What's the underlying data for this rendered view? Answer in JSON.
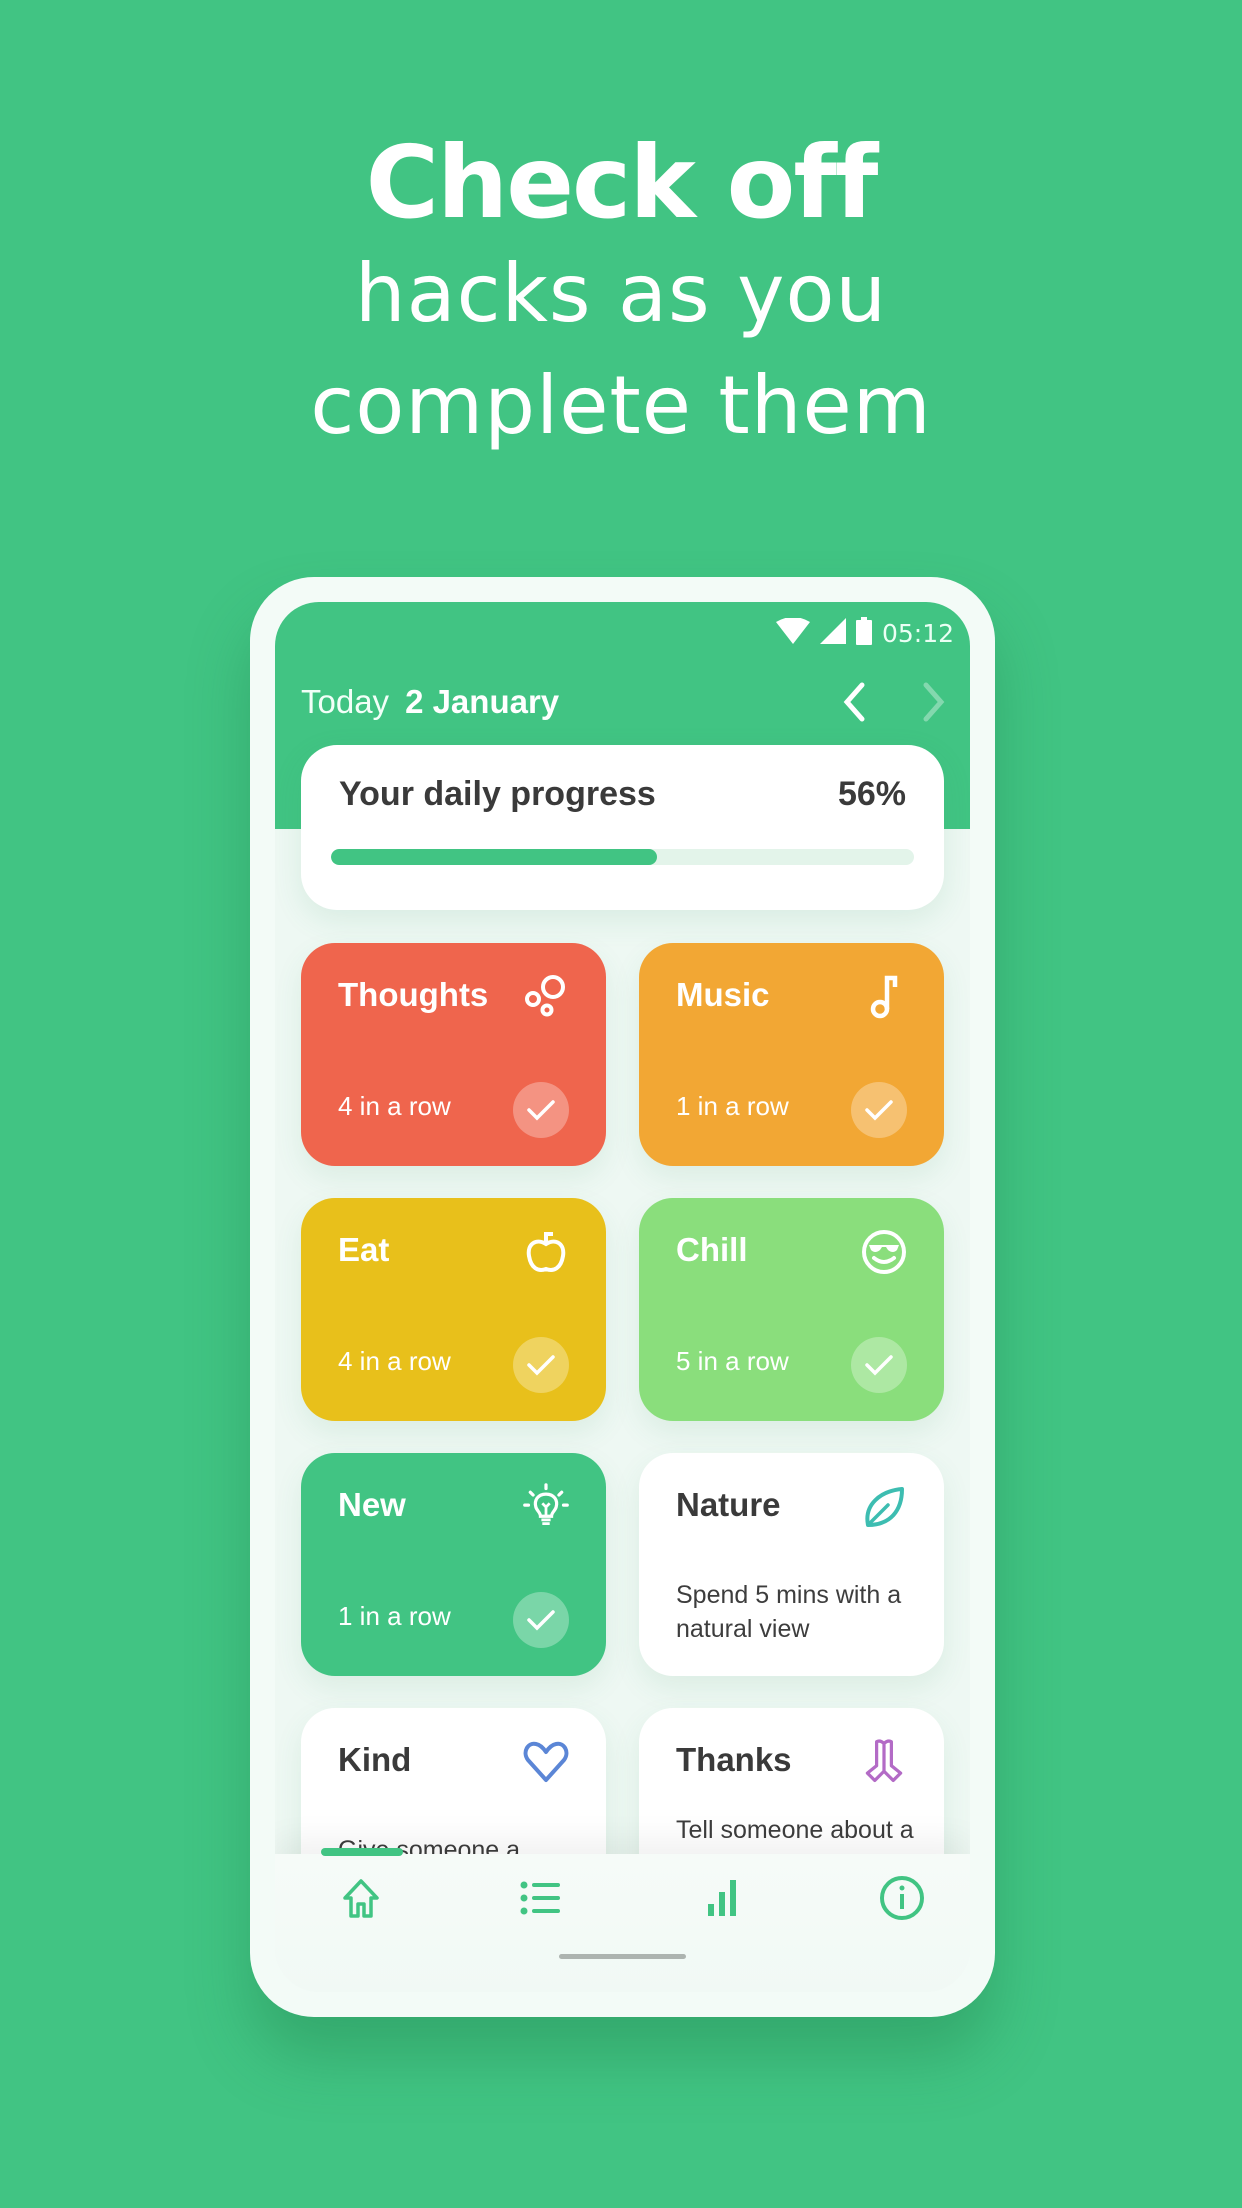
{
  "headline": {
    "title": "Check off",
    "subtitle_line1": "hacks as you",
    "subtitle_line2": "complete them"
  },
  "status_bar": {
    "time": "05:12",
    "icons": [
      "wifi-icon",
      "signal-icon",
      "battery-icon"
    ]
  },
  "header": {
    "today_label": "Today",
    "date": "2 January",
    "prev_icon": "chevron-left-icon",
    "next_icon": "chevron-right-icon"
  },
  "progress": {
    "title": "Your daily progress",
    "value_label": "56%",
    "percent": 56
  },
  "cards": [
    {
      "title": "Thoughts",
      "icon": "bubbles-icon",
      "status": "done",
      "streak": "4 in a row",
      "color": "#ef654d"
    },
    {
      "title": "Music",
      "icon": "music-note-icon",
      "status": "done",
      "streak": "1 in a row",
      "color": "#f2a734"
    },
    {
      "title": "Eat",
      "icon": "apple-icon",
      "status": "done",
      "streak": "4 in a row",
      "color": "#e8c01b"
    },
    {
      "title": "Chill",
      "icon": "sunglasses-smiley-icon",
      "status": "done",
      "streak": "5 in a row",
      "color": "#8ade7c"
    },
    {
      "title": "New",
      "icon": "lightbulb-icon",
      "status": "done",
      "streak": "1 in a row",
      "color": "#41c483"
    },
    {
      "title": "Nature",
      "icon": "leaf-icon",
      "status": "todo",
      "description": "Spend 5 mins with a natural view",
      "icon_color": "#3dbdb1"
    },
    {
      "title": "Kind",
      "icon": "heart-icon",
      "status": "todo",
      "description": "Give someone a compliment",
      "icon_color": "#5b86d6"
    },
    {
      "title": "Thanks",
      "icon": "praying-hands-icon",
      "status": "todo",
      "description": "Tell someone about a thing you’re thankful for",
      "icon_color": "#b36bc6"
    }
  ],
  "bottom_nav": {
    "items": [
      {
        "name": "home",
        "icon": "home-icon",
        "active": true
      },
      {
        "name": "list",
        "icon": "list-icon",
        "active": false
      },
      {
        "name": "stats",
        "icon": "bar-chart-icon",
        "active": false
      },
      {
        "name": "info",
        "icon": "info-icon",
        "active": false
      }
    ]
  },
  "colors": {
    "brand": "#41c483",
    "text_dark": "#3a3a3a"
  }
}
